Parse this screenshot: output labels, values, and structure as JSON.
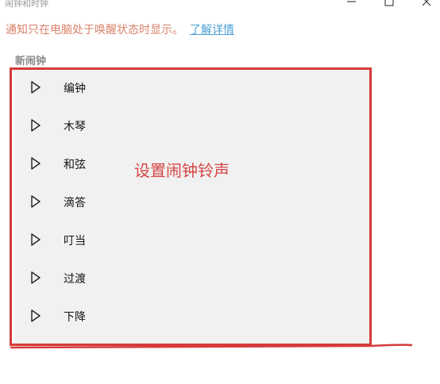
{
  "window": {
    "title": "闹钟和时钟",
    "controls": {
      "minimize_icon": "minimize-icon",
      "maximize_icon": "maximize-icon",
      "close_icon": "close-icon"
    }
  },
  "notice": {
    "text": "通知只在电脑处于唤醒状态时显示。",
    "link": "了解详情"
  },
  "section": {
    "title": "新闹钟"
  },
  "sound_list": {
    "items": [
      {
        "label": "编钟",
        "icon": "play-icon"
      },
      {
        "label": "木琴",
        "icon": "play-icon"
      },
      {
        "label": "和弦",
        "icon": "play-icon"
      },
      {
        "label": "滴答",
        "icon": "play-icon"
      },
      {
        "label": "叮当",
        "icon": "play-icon"
      },
      {
        "label": "过渡",
        "icon": "play-icon"
      },
      {
        "label": "下降",
        "icon": "play-icon"
      }
    ]
  },
  "annotation": {
    "text": "设置闹钟铃声"
  },
  "colors": {
    "notice_text": "#d9826a",
    "link": "#4a9fd4",
    "dropdown_bg": "#f1f1f1",
    "annotation_red": "#d63b3b"
  }
}
